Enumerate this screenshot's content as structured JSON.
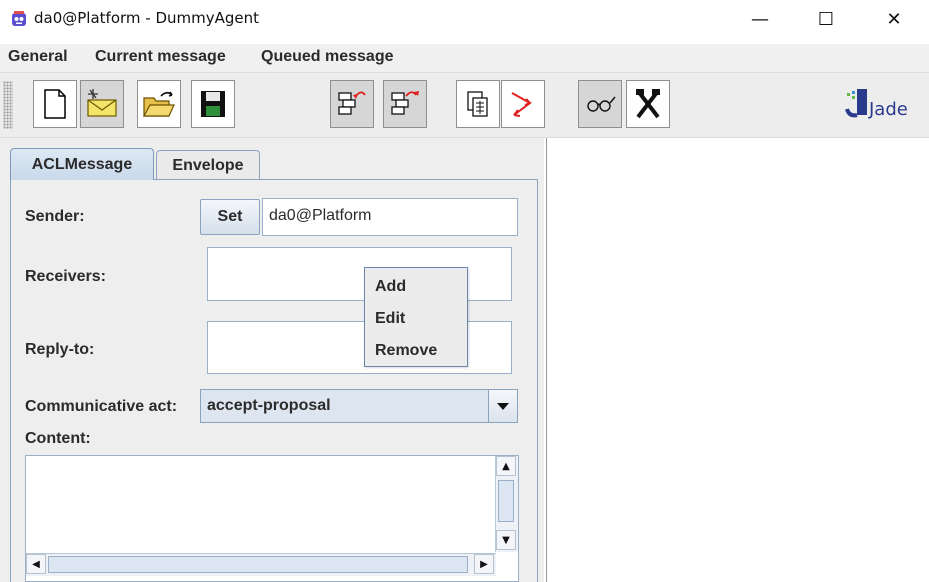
{
  "window": {
    "title": "da0@Platform - DummyAgent",
    "controls": {
      "minimize": "—",
      "maximize": "☐",
      "close": "✕"
    }
  },
  "menubar": {
    "items": [
      "General",
      "Current message",
      "Queued message"
    ]
  },
  "toolbar": {
    "buttons": [
      {
        "icon": "new-message-icon"
      },
      {
        "icon": "open-mailbox-icon"
      },
      {
        "icon": "open-folder-icon"
      },
      {
        "icon": "save-icon"
      },
      {
        "icon": "send-icon"
      },
      {
        "icon": "reply-icon"
      },
      {
        "icon": "queue-icon"
      },
      {
        "icon": "route-icon"
      },
      {
        "icon": "view-glasses-icon"
      },
      {
        "icon": "delete-x-icon"
      }
    ],
    "logo_text": "Jade"
  },
  "tabs": {
    "active": "ACLMessage",
    "inactive": "Envelope"
  },
  "form": {
    "sender_label": "Sender:",
    "set_button": "Set",
    "sender_value": "da0@Platform",
    "receivers_label": "Receivers:",
    "reply_to_label": "Reply-to:",
    "communicative_act_label": "Communicative act:",
    "communicative_act_value": "accept-proposal",
    "content_label": "Content:"
  },
  "popup_menu": {
    "items": [
      "Add",
      "Edit",
      "Remove"
    ]
  },
  "colors": {
    "accent": "#c9d9ea",
    "border": "#8aa3bf",
    "red_arrow": "#e02020"
  }
}
